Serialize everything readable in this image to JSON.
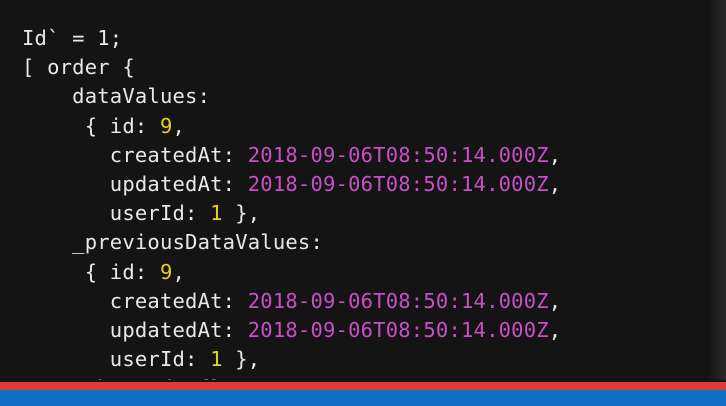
{
  "terminal": {
    "lines": [
      [
        {
          "t": "Id` = 1;",
          "c": ""
        }
      ],
      [
        {
          "t": "[ order {",
          "c": ""
        }
      ],
      [
        {
          "t": "    dataValues:",
          "c": ""
        }
      ],
      [
        {
          "t": "     { id: ",
          "c": ""
        },
        {
          "t": "9",
          "c": "num"
        },
        {
          "t": ",",
          "c": ""
        }
      ],
      [
        {
          "t": "       createdAt: ",
          "c": ""
        },
        {
          "t": "2018-09-06T08:50:14.000Z",
          "c": "str"
        },
        {
          "t": ",",
          "c": ""
        }
      ],
      [
        {
          "t": "       updatedAt: ",
          "c": ""
        },
        {
          "t": "2018-09-06T08:50:14.000Z",
          "c": "str"
        },
        {
          "t": ",",
          "c": ""
        }
      ],
      [
        {
          "t": "       userId: ",
          "c": ""
        },
        {
          "t": "1",
          "c": "num"
        },
        {
          "t": " },",
          "c": ""
        }
      ],
      [
        {
          "t": "    _previousDataValues:",
          "c": ""
        }
      ],
      [
        {
          "t": "     { id: ",
          "c": ""
        },
        {
          "t": "9",
          "c": "num"
        },
        {
          "t": ",",
          "c": ""
        }
      ],
      [
        {
          "t": "       createdAt: ",
          "c": ""
        },
        {
          "t": "2018-09-06T08:50:14.000Z",
          "c": "str"
        },
        {
          "t": ",",
          "c": ""
        }
      ],
      [
        {
          "t": "       updatedAt: ",
          "c": ""
        },
        {
          "t": "2018-09-06T08:50:14.000Z",
          "c": "str"
        },
        {
          "t": ",",
          "c": ""
        }
      ],
      [
        {
          "t": "       userId: ",
          "c": ""
        },
        {
          "t": "1",
          "c": "num"
        },
        {
          "t": " },",
          "c": ""
        }
      ],
      [
        {
          "t": "    _changed: {},",
          "c": ""
        }
      ]
    ]
  },
  "video_progress": {
    "fraction": 1.0
  },
  "colors": {
    "background": "#141414",
    "text": "#e8e8e8",
    "string": "#c94fc7",
    "number": "#e6d21d",
    "progress": "#e0393a",
    "taskbar": "#0f6fc6"
  }
}
